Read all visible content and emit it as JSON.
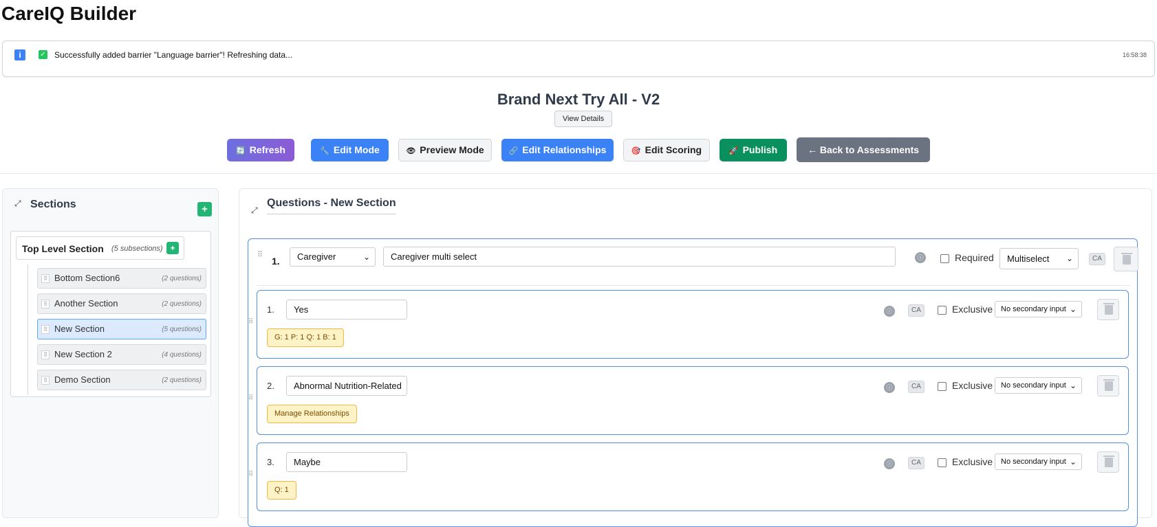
{
  "app": {
    "title": "CareIQ Builder"
  },
  "notification": {
    "message": "Successfully added barrier \"Language barrier\"! Refreshing data...",
    "time": "16:58:38"
  },
  "assessment": {
    "title": "Brand Next Try All - V2",
    "view_details": "View Details"
  },
  "toolbar": {
    "refresh": "Refresh",
    "edit_mode": "Edit Mode",
    "preview_mode": "Preview Mode",
    "edit_relationships": "Edit Relationships",
    "edit_scoring": "Edit Scoring",
    "publish": "Publish",
    "back": "← Back to Assessments",
    "accent": "#3b82f6",
    "publish_color": "#0a8f5e"
  },
  "sections": {
    "title": "Sections",
    "add": "+",
    "top_level": {
      "label": "Top Level Section",
      "count": "(5 subsections)",
      "add": "+"
    },
    "items": [
      {
        "name": "Bottom Section6",
        "count": "(2 questions)"
      },
      {
        "name": "Another Section",
        "count": "(2 questions)"
      },
      {
        "name": "New Section",
        "count": "(5 questions)",
        "active": true
      },
      {
        "name": "New Section 2",
        "count": "(4 questions)"
      },
      {
        "name": "Demo Section",
        "count": "(2 questions)"
      }
    ]
  },
  "questions": {
    "title": "Questions - New Section",
    "question": {
      "number": "1.",
      "category": "Caregiver",
      "text": "Caregiver multi select",
      "required_label": "Required",
      "type": "Multiselect",
      "ca": "CA"
    },
    "answers": [
      {
        "number": "1.",
        "text": "Yes",
        "ca": "CA",
        "exclusive_label": "Exclusive",
        "secondary": "No secondary input",
        "tag": "G: 1 P: 1 Q: 1 B: 1"
      },
      {
        "number": "2.",
        "text": "Abnormal Nutrition-Related",
        "ca": "CA",
        "exclusive_label": "Exclusive",
        "secondary": "No secondary input",
        "tag": "Manage Relationships"
      },
      {
        "number": "3.",
        "text": "Maybe",
        "ca": "CA",
        "exclusive_label": "Exclusive",
        "secondary": "No secondary input",
        "tag": "Q: 1"
      }
    ]
  }
}
